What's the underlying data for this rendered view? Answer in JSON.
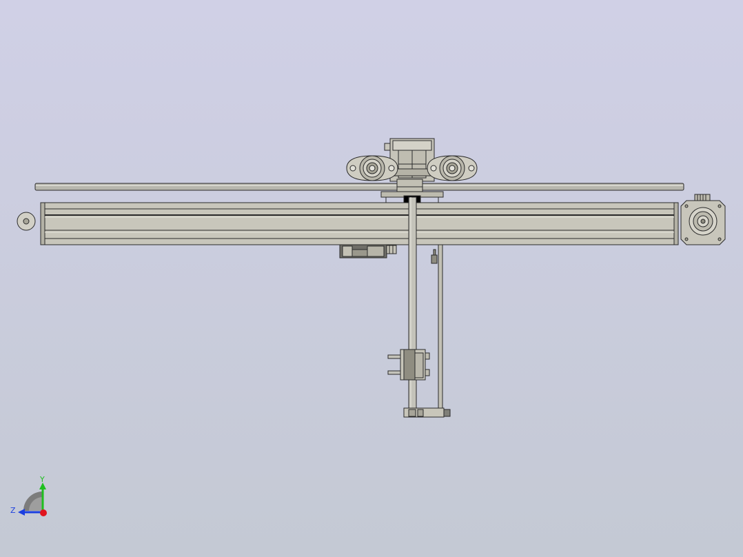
{
  "viewport": {
    "background_top": "#d0d0e6",
    "background_bottom": "#c4c9d4"
  },
  "model": {
    "body_color": "#c9c7bd",
    "body_dark": "#a5a396",
    "edge_color": "#2a2a2a",
    "highlight": "#e6e5de",
    "nut_color": "#7f7f78"
  },
  "triad": {
    "y_label": "Y",
    "z_label": "Z",
    "y_color": "#1fbf1f",
    "z_color": "#1b3fe0",
    "x_color": "#e0141e",
    "hub_color": "#7c7c7c"
  }
}
